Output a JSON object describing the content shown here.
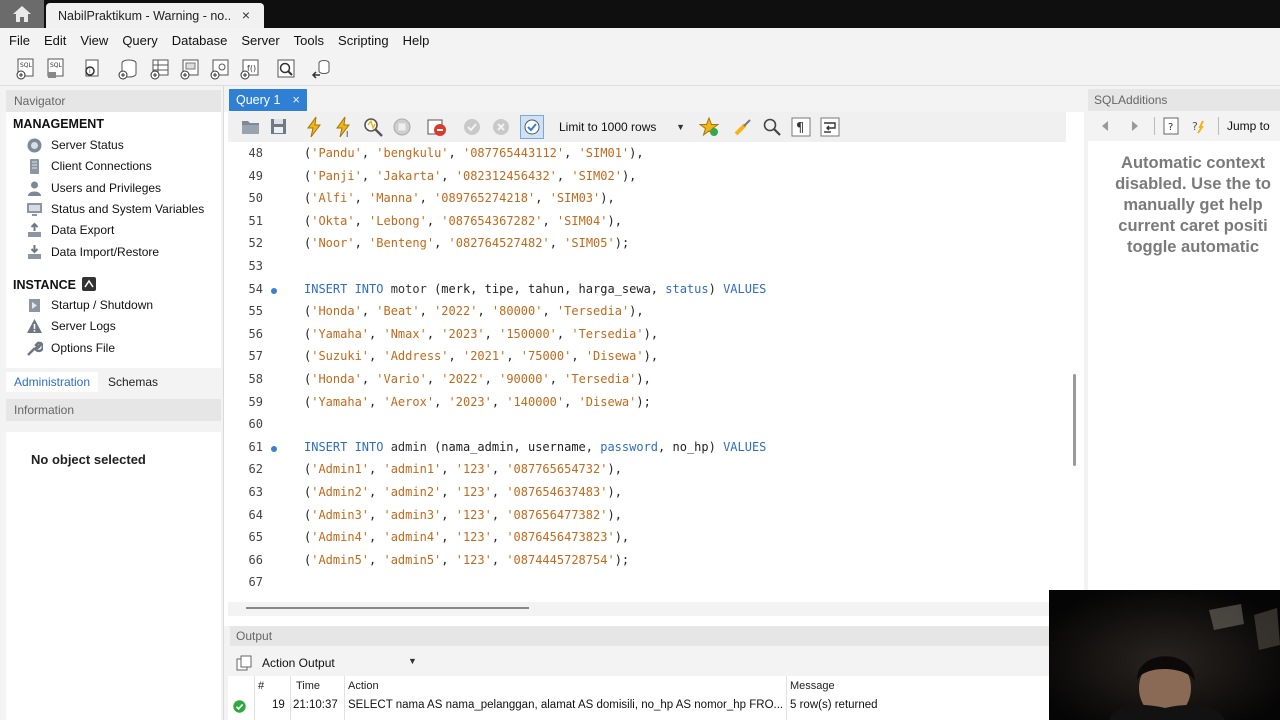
{
  "window_tab": {
    "title": "NabilPraktikum - Warning - no...",
    "close": "×"
  },
  "menu": [
    "File",
    "Edit",
    "View",
    "Query",
    "Database",
    "Server",
    "Tools",
    "Scripting",
    "Help"
  ],
  "navigator": {
    "header": "Navigator",
    "management_title": "MANAGEMENT",
    "management_items": [
      "Server Status",
      "Client Connections",
      "Users and Privileges",
      "Status and System Variables",
      "Data Export",
      "Data Import/Restore"
    ],
    "instance_title": "INSTANCE",
    "instance_items": [
      "Startup / Shutdown",
      "Server Logs",
      "Options File"
    ],
    "tabs": [
      "Administration",
      "Schemas"
    ],
    "information_header": "Information",
    "no_object": "No object selected"
  },
  "query": {
    "tab_label": "Query 1",
    "tab_close": "×",
    "limit_label": "Limit to 1000 rows"
  },
  "editor": {
    "lines": [
      {
        "n": "48",
        "marker": false,
        "tokens": [
          [
            "p",
            "("
          ],
          [
            "s",
            "'Pandu'"
          ],
          [
            "p",
            ", "
          ],
          [
            "s",
            "'bengkulu'"
          ],
          [
            "p",
            ", "
          ],
          [
            "s",
            "'087765443112'"
          ],
          [
            "p",
            ", "
          ],
          [
            "s",
            "'SIM01'"
          ],
          [
            "p",
            "),"
          ]
        ]
      },
      {
        "n": "49",
        "marker": false,
        "tokens": [
          [
            "p",
            "("
          ],
          [
            "s",
            "'Panji'"
          ],
          [
            "p",
            ", "
          ],
          [
            "s",
            "'Jakarta'"
          ],
          [
            "p",
            ", "
          ],
          [
            "s",
            "'082312456432'"
          ],
          [
            "p",
            ", "
          ],
          [
            "s",
            "'SIM02'"
          ],
          [
            "p",
            "),"
          ]
        ]
      },
      {
        "n": "50",
        "marker": false,
        "tokens": [
          [
            "p",
            "("
          ],
          [
            "s",
            "'Alfi'"
          ],
          [
            "p",
            ", "
          ],
          [
            "s",
            "'Manna'"
          ],
          [
            "p",
            ", "
          ],
          [
            "s",
            "'089765274218'"
          ],
          [
            "p",
            ", "
          ],
          [
            "s",
            "'SIM03'"
          ],
          [
            "p",
            "),"
          ]
        ]
      },
      {
        "n": "51",
        "marker": false,
        "tokens": [
          [
            "p",
            "("
          ],
          [
            "s",
            "'Okta'"
          ],
          [
            "p",
            ", "
          ],
          [
            "s",
            "'Lebong'"
          ],
          [
            "p",
            ", "
          ],
          [
            "s",
            "'087654367282'"
          ],
          [
            "p",
            ", "
          ],
          [
            "s",
            "'SIM04'"
          ],
          [
            "p",
            "),"
          ]
        ]
      },
      {
        "n": "52",
        "marker": false,
        "tokens": [
          [
            "p",
            "("
          ],
          [
            "s",
            "'Noor'"
          ],
          [
            "p",
            ", "
          ],
          [
            "s",
            "'Benteng'"
          ],
          [
            "p",
            ", "
          ],
          [
            "s",
            "'082764527482'"
          ],
          [
            "p",
            ", "
          ],
          [
            "s",
            "'SIM05'"
          ],
          [
            "p",
            ");"
          ]
        ]
      },
      {
        "n": "53",
        "marker": false,
        "tokens": []
      },
      {
        "n": "54",
        "marker": true,
        "tokens": [
          [
            "k",
            "INSERT INTO "
          ],
          [
            "c",
            "motor "
          ],
          [
            "p",
            "(merk, tipe, tahun, harga_sewa, "
          ],
          [
            "k",
            "status"
          ],
          [
            "p",
            ") "
          ],
          [
            "k",
            "VALUES"
          ]
        ]
      },
      {
        "n": "55",
        "marker": false,
        "tokens": [
          [
            "p",
            "("
          ],
          [
            "s",
            "'Honda'"
          ],
          [
            "p",
            ", "
          ],
          [
            "s",
            "'Beat'"
          ],
          [
            "p",
            ", "
          ],
          [
            "s",
            "'2022'"
          ],
          [
            "p",
            ", "
          ],
          [
            "s",
            "'80000'"
          ],
          [
            "p",
            ", "
          ],
          [
            "s",
            "'Tersedia'"
          ],
          [
            "p",
            "),"
          ]
        ]
      },
      {
        "n": "56",
        "marker": false,
        "tokens": [
          [
            "p",
            "("
          ],
          [
            "s",
            "'Yamaha'"
          ],
          [
            "p",
            ", "
          ],
          [
            "s",
            "'Nmax'"
          ],
          [
            "p",
            ", "
          ],
          [
            "s",
            "'2023'"
          ],
          [
            "p",
            ", "
          ],
          [
            "s",
            "'150000'"
          ],
          [
            "p",
            ", "
          ],
          [
            "s",
            "'Tersedia'"
          ],
          [
            "p",
            "),"
          ]
        ]
      },
      {
        "n": "57",
        "marker": false,
        "tokens": [
          [
            "p",
            "("
          ],
          [
            "s",
            "'Suzuki'"
          ],
          [
            "p",
            ", "
          ],
          [
            "s",
            "'Address'"
          ],
          [
            "p",
            ", "
          ],
          [
            "s",
            "'2021'"
          ],
          [
            "p",
            ", "
          ],
          [
            "s",
            "'75000'"
          ],
          [
            "p",
            ", "
          ],
          [
            "s",
            "'Disewa'"
          ],
          [
            "p",
            "),"
          ]
        ]
      },
      {
        "n": "58",
        "marker": false,
        "tokens": [
          [
            "p",
            "("
          ],
          [
            "s",
            "'Honda'"
          ],
          [
            "p",
            ", "
          ],
          [
            "s",
            "'Vario'"
          ],
          [
            "p",
            ", "
          ],
          [
            "s",
            "'2022'"
          ],
          [
            "p",
            ", "
          ],
          [
            "s",
            "'90000'"
          ],
          [
            "p",
            ", "
          ],
          [
            "s",
            "'Tersedia'"
          ],
          [
            "p",
            "),"
          ]
        ]
      },
      {
        "n": "59",
        "marker": false,
        "tokens": [
          [
            "p",
            "("
          ],
          [
            "s",
            "'Yamaha'"
          ],
          [
            "p",
            ", "
          ],
          [
            "s",
            "'Aerox'"
          ],
          [
            "p",
            ", "
          ],
          [
            "s",
            "'2023'"
          ],
          [
            "p",
            ", "
          ],
          [
            "s",
            "'140000'"
          ],
          [
            "p",
            ", "
          ],
          [
            "s",
            "'Disewa'"
          ],
          [
            "p",
            ");"
          ]
        ]
      },
      {
        "n": "60",
        "marker": false,
        "tokens": []
      },
      {
        "n": "61",
        "marker": true,
        "tokens": [
          [
            "k",
            "INSERT INTO "
          ],
          [
            "c",
            "admin "
          ],
          [
            "p",
            "(nama_admin, username, "
          ],
          [
            "k",
            "password"
          ],
          [
            "p",
            ", no_hp) "
          ],
          [
            "k",
            "VALUES"
          ]
        ]
      },
      {
        "n": "62",
        "marker": false,
        "tokens": [
          [
            "p",
            "("
          ],
          [
            "s",
            "'Admin1'"
          ],
          [
            "p",
            ", "
          ],
          [
            "s",
            "'admin1'"
          ],
          [
            "p",
            ", "
          ],
          [
            "s",
            "'123'"
          ],
          [
            "p",
            ", "
          ],
          [
            "s",
            "'087765654732'"
          ],
          [
            "p",
            "),"
          ]
        ]
      },
      {
        "n": "63",
        "marker": false,
        "tokens": [
          [
            "p",
            "("
          ],
          [
            "s",
            "'Admin2'"
          ],
          [
            "p",
            ", "
          ],
          [
            "s",
            "'admin2'"
          ],
          [
            "p",
            ", "
          ],
          [
            "s",
            "'123'"
          ],
          [
            "p",
            ", "
          ],
          [
            "s",
            "'087654637483'"
          ],
          [
            "p",
            "),"
          ]
        ]
      },
      {
        "n": "64",
        "marker": false,
        "tokens": [
          [
            "p",
            "("
          ],
          [
            "s",
            "'Admin3'"
          ],
          [
            "p",
            ", "
          ],
          [
            "s",
            "'admin3'"
          ],
          [
            "p",
            ", "
          ],
          [
            "s",
            "'123'"
          ],
          [
            "p",
            ", "
          ],
          [
            "s",
            "'087656477382'"
          ],
          [
            "p",
            "),"
          ]
        ]
      },
      {
        "n": "65",
        "marker": false,
        "tokens": [
          [
            "p",
            "("
          ],
          [
            "s",
            "'Admin4'"
          ],
          [
            "p",
            ", "
          ],
          [
            "s",
            "'admin4'"
          ],
          [
            "p",
            ", "
          ],
          [
            "s",
            "'123'"
          ],
          [
            "p",
            ", "
          ],
          [
            "s",
            "'0876456473823'"
          ],
          [
            "p",
            "),"
          ]
        ]
      },
      {
        "n": "66",
        "marker": false,
        "tokens": [
          [
            "p",
            "("
          ],
          [
            "s",
            "'Admin5'"
          ],
          [
            "p",
            ", "
          ],
          [
            "s",
            "'admin5'"
          ],
          [
            "p",
            ", "
          ],
          [
            "s",
            "'123'"
          ],
          [
            "p",
            ", "
          ],
          [
            "s",
            "'0874445728754'"
          ],
          [
            "p",
            ");"
          ]
        ]
      },
      {
        "n": "67",
        "marker": false,
        "tokens": []
      }
    ]
  },
  "output": {
    "header": "Output",
    "mode": "Action Output",
    "columns": {
      "num": "#",
      "time": "Time",
      "action": "Action",
      "message": "Message"
    },
    "rows": [
      {
        "num": "19",
        "time": "21:10:37",
        "action": "SELECT nama AS nama_pelanggan, alamat AS domisili, no_hp AS nomor_hp FRO...",
        "message": "5 row(s) returned",
        "status": "success"
      }
    ]
  },
  "sql_additions": {
    "header": "SQLAdditions",
    "jump_label": "Jump to",
    "help_text": [
      "Automatic context",
      "disabled. Use the to",
      "manually get help",
      "current caret positi",
      "toggle automatic"
    ]
  },
  "colors": {
    "accent": "#2f80d4",
    "keyword": "#2f6ec2",
    "string": "#c06a1c",
    "success": "#2eaa3c"
  }
}
